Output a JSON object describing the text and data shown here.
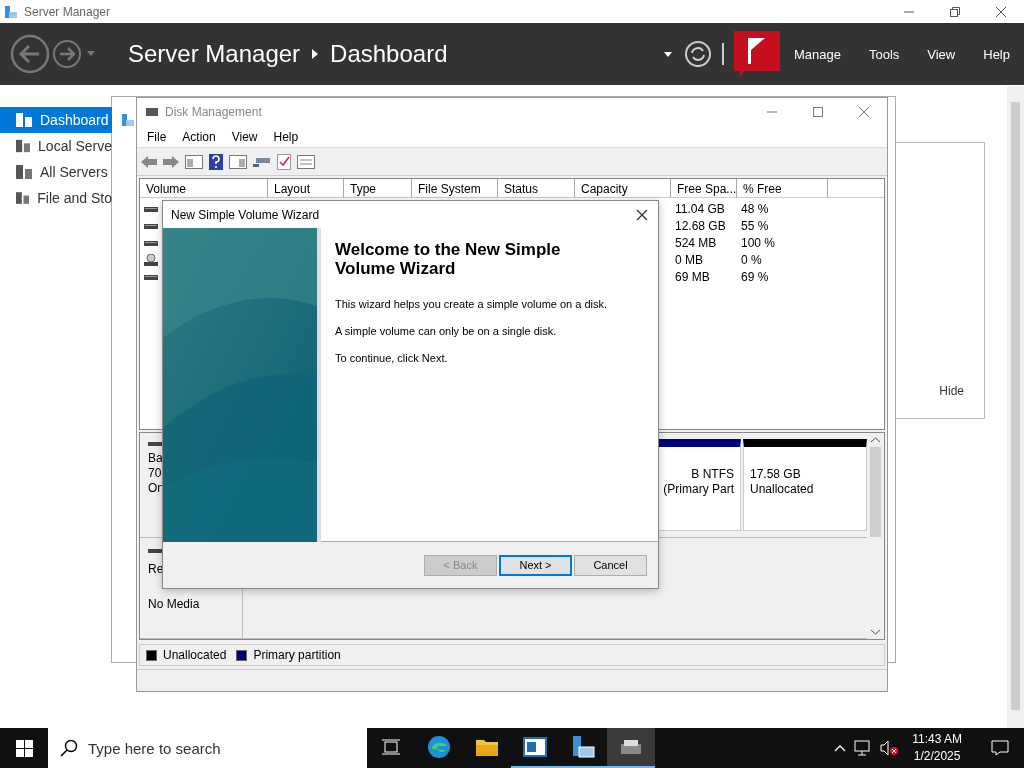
{
  "server_manager": {
    "title": "Server Manager",
    "breadcrumb": [
      "Server Manager",
      "Dashboard"
    ],
    "menu": [
      "Manage",
      "Tools",
      "View",
      "Help"
    ],
    "sidebar": [
      {
        "label": "Dashboard",
        "selected": true
      },
      {
        "label": "Local Serve",
        "selected": false
      },
      {
        "label": "All Servers",
        "selected": false
      },
      {
        "label": "File and Sto",
        "selected": false
      }
    ],
    "hide_button": "Hide"
  },
  "disk_management": {
    "title": "Disk Management",
    "menu": [
      "File",
      "Action",
      "View",
      "Help"
    ],
    "columns": [
      "Volume",
      "Layout",
      "Type",
      "File System",
      "Status",
      "Capacity",
      "Free Spa...",
      "% Free"
    ],
    "rows": [
      {
        "kind": "disk",
        "free_space": "11.04 GB",
        "percent_free": "48 %"
      },
      {
        "kind": "disk",
        "free_space": "12.68 GB",
        "percent_free": "55 %"
      },
      {
        "kind": "disk",
        "free_space": "524 MB",
        "percent_free": "100 %"
      },
      {
        "kind": "optical",
        "free_space": "0 MB",
        "percent_free": "0 %"
      },
      {
        "kind": "disk",
        "free_space": "69 MB",
        "percent_free": "69 %"
      }
    ],
    "disks": [
      {
        "label_lines": [
          "Ba",
          "70",
          "On"
        ],
        "partitions": [
          {
            "kind": "primary",
            "lines": [
              "B NTFS",
              "(Primary Part"
            ]
          },
          {
            "kind": "unallocated",
            "lines": [
              "17.58 GB",
              "Unallocated"
            ]
          }
        ]
      },
      {
        "label_lines": [
          "Re",
          "No Media"
        ]
      }
    ],
    "legend": [
      {
        "label": "Unallocated",
        "color": "#000000"
      },
      {
        "label": "Primary partition",
        "color": "#000080"
      }
    ]
  },
  "wizard": {
    "title": "New Simple Volume Wizard",
    "heading": "Welcome to the New Simple Volume Wizard",
    "paragraphs": [
      "This wizard helps you create a simple volume on a disk.",
      "A simple volume can only be on a single disk.",
      "To continue, click Next."
    ],
    "buttons": [
      {
        "label": "< Back",
        "disabled": true,
        "default": false
      },
      {
        "label": "Next >",
        "disabled": false,
        "default": true
      },
      {
        "label": "Cancel",
        "disabled": false,
        "default": false
      }
    ]
  },
  "taskbar": {
    "search": {
      "placeholder": "Type here to search"
    },
    "apps": [
      {
        "kind": "edge",
        "running": false,
        "active": false
      },
      {
        "kind": "explorer",
        "running": false,
        "active": false
      },
      {
        "kind": "window",
        "running": true,
        "active": false
      },
      {
        "kind": "server",
        "running": true,
        "active": false
      },
      {
        "kind": "drive",
        "running": true,
        "active": true
      }
    ],
    "time": "11:43 AM",
    "date": "1/2/2025"
  }
}
